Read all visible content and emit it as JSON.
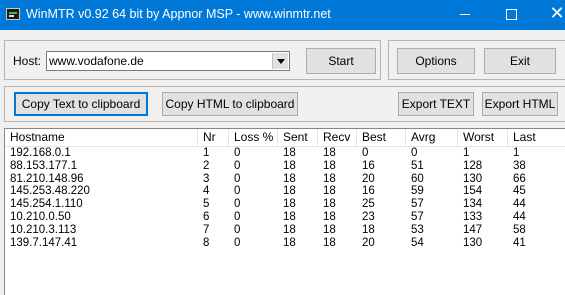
{
  "window": {
    "title": "WinMTR v0.92 64 bit by Appnor MSP - www.winmtr.net"
  },
  "host": {
    "label": "Host:",
    "value": "www.vodafone.de"
  },
  "buttons": {
    "start": "Start",
    "options": "Options",
    "exit": "Exit",
    "copy_text": "Copy Text to clipboard",
    "copy_html": "Copy HTML to clipboard",
    "export_text": "Export TEXT",
    "export_html": "Export HTML"
  },
  "table": {
    "columns": [
      "Hostname",
      "Nr",
      "Loss %",
      "Sent",
      "Recv",
      "Best",
      "Avrg",
      "Worst",
      "Last"
    ],
    "rows": [
      [
        "192.168.0.1",
        "1",
        "0",
        "18",
        "18",
        "0",
        "0",
        "1",
        "1"
      ],
      [
        "88.153.177.1",
        "2",
        "0",
        "18",
        "18",
        "16",
        "51",
        "128",
        "38"
      ],
      [
        "81.210.148.96",
        "3",
        "0",
        "18",
        "18",
        "20",
        "60",
        "130",
        "66"
      ],
      [
        "145.253.48.220",
        "4",
        "0",
        "18",
        "18",
        "16",
        "59",
        "154",
        "45"
      ],
      [
        "145.254.1.110",
        "5",
        "0",
        "18",
        "18",
        "25",
        "57",
        "134",
        "44"
      ],
      [
        "10.210.0.50",
        "6",
        "0",
        "18",
        "18",
        "23",
        "57",
        "133",
        "44"
      ],
      [
        "10.210.3.113",
        "7",
        "0",
        "18",
        "18",
        "18",
        "53",
        "147",
        "58"
      ],
      [
        "139.7.147.41",
        "8",
        "0",
        "18",
        "18",
        "20",
        "54",
        "130",
        "41"
      ]
    ]
  }
}
